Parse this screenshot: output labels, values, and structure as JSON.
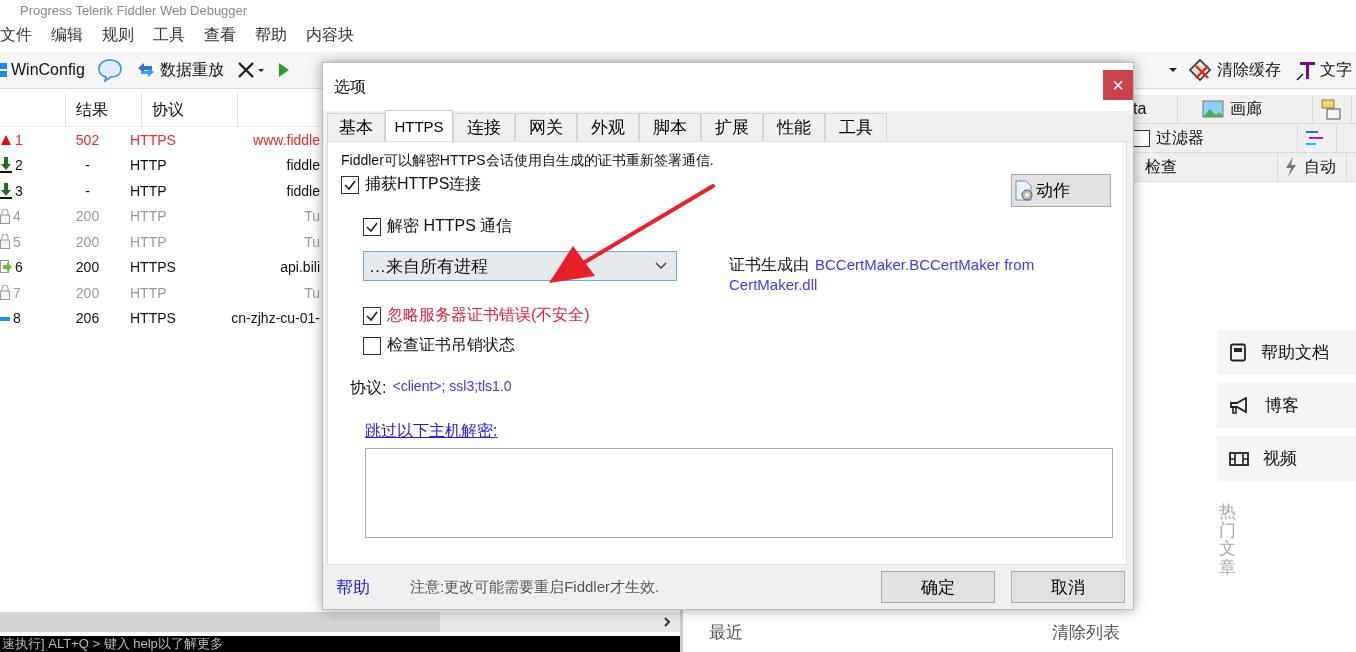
{
  "window": {
    "title": "Progress Telerik Fiddler Web Debugger"
  },
  "menu": [
    "文件",
    "编辑",
    "规则",
    "工具",
    "查看",
    "帮助",
    "内容块"
  ],
  "toolbar": {
    "left": [
      {
        "kind": "windows",
        "label": "WinConfig"
      },
      {
        "kind": "bubble"
      },
      {
        "kind": "replay",
        "label": "数据重放"
      },
      {
        "kind": "remove"
      },
      {
        "kind": "play"
      }
    ],
    "right": [
      {
        "kind": "clear",
        "label": "清除缓存"
      },
      {
        "kind": "text",
        "label": "文字"
      }
    ]
  },
  "sessions": {
    "columns": [
      "结果",
      "协议"
    ],
    "rows": [
      {
        "kind": "error",
        "id": "1",
        "result": "502",
        "protocol": "HTTPS",
        "host": "www.fiddle"
      },
      {
        "kind": "pending",
        "id": "2",
        "result": "-",
        "protocol": "HTTP",
        "host": "fiddle"
      },
      {
        "kind": "pending",
        "id": "3",
        "result": "-",
        "protocol": "HTTP",
        "host": "fiddle"
      },
      {
        "kind": "tunnel",
        "id": "4",
        "result": "200",
        "protocol": "HTTP",
        "host": "Tu"
      },
      {
        "kind": "tunnel",
        "id": "5",
        "result": "200",
        "protocol": "HTTP",
        "host": "Tu"
      },
      {
        "kind": "json",
        "id": "6",
        "result": "200",
        "protocol": "HTTPS",
        "host": "api.bili"
      },
      {
        "kind": "tunnel",
        "id": "7",
        "result": "200",
        "protocol": "HTTP",
        "host": "Tu"
      },
      {
        "kind": "stream",
        "id": "8",
        "result": "206",
        "protocol": "HTTPS",
        "host": "cn-zjhz-cu-01-"
      }
    ]
  },
  "quickexec": "速执行] ALT+Q > 键入 help以了解更多",
  "right_tabs": [
    [
      {
        "kind": "plain",
        "label": "ta",
        "selected": false
      },
      {
        "kind": "gallery",
        "label": "画廊",
        "selected": false
      },
      {
        "kind": "script",
        "selected": false
      }
    ],
    [
      {
        "kind": "filter",
        "label": "过滤器",
        "checked": false,
        "selected": false
      },
      {
        "kind": "timeline",
        "selected": false
      }
    ],
    [
      {
        "kind": "plain",
        "label": "检查",
        "selected": false
      },
      {
        "kind": "auto",
        "label": "自动",
        "selected": false
      }
    ]
  ],
  "side_links": [
    {
      "kind": "book",
      "label": "帮助文档"
    },
    {
      "kind": "megaphone",
      "label": "博客"
    },
    {
      "kind": "film",
      "label": "视频"
    }
  ],
  "hot_articles": "热门文章",
  "recent": {
    "title": "最近",
    "clear": "清除列表"
  },
  "dialog": {
    "title": "选项",
    "close": "×",
    "tabs": [
      {
        "label": "基本",
        "selected": false
      },
      {
        "label": "HTTPS",
        "selected": true
      },
      {
        "label": "连接",
        "selected": false
      },
      {
        "label": "网关",
        "selected": false
      },
      {
        "label": "外观",
        "selected": false
      },
      {
        "label": "脚本",
        "selected": false
      },
      {
        "label": "扩展",
        "selected": false
      },
      {
        "label": "性能",
        "selected": false
      },
      {
        "label": "工具",
        "selected": false
      }
    ],
    "description": "Fiddler可以解密HTTPS会话使用自生成的证书重新签署通信.",
    "capture_https": {
      "label": "捕获HTTPS连接",
      "checked": true
    },
    "action_button": "动作",
    "decrypt_https": {
      "label": "解密 HTTPS 通信",
      "checked": true
    },
    "process_filter": "…来自所有进程",
    "cert_maker": {
      "label": "证书生成由",
      "value": "BCCertMaker.BCCertMaker from CertMaker.dll"
    },
    "ignore_cert_errors": {
      "label": "忽略服务器证书错误(不安全)",
      "checked": true
    },
    "check_revocation": {
      "label": "检查证书吊销状态",
      "checked": false
    },
    "protocols": {
      "label": "协议:",
      "value": "<client>; ssl3;tls1.0"
    },
    "skip_link": "跳过以下主机解密:",
    "help_link": "帮助",
    "note": "注意:更改可能需要重启Fiddler才生效.",
    "buttons": [
      "确定",
      "取消"
    ]
  }
}
